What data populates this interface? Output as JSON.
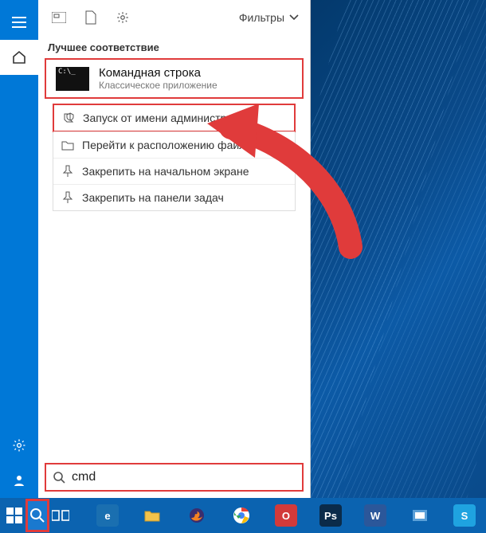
{
  "toolbar": {
    "filters_label": "Фильтры"
  },
  "section": {
    "best_match": "Лучшее соответствие"
  },
  "best": {
    "title": "Командная строка",
    "subtitle": "Классическое приложение"
  },
  "context_menu": {
    "run_as_admin": "Запуск от имени администратора",
    "open_location": "Перейти к расположению файла",
    "pin_start": "Закрепить на начальном экране",
    "pin_taskbar": "Закрепить на панели задач"
  },
  "search": {
    "value": "cmd",
    "placeholder": ""
  },
  "taskbar_apps": [
    {
      "name": "edge",
      "bg": "#1a6fb0",
      "label": "e"
    },
    {
      "name": "explorer",
      "bg": "#f3c34b",
      "label": ""
    },
    {
      "name": "firefox",
      "bg": "#3a2d6e",
      "label": ""
    },
    {
      "name": "chrome",
      "bg": "#ffffff",
      "label": ""
    },
    {
      "name": "opera",
      "bg": "#d23a3a",
      "label": "O"
    },
    {
      "name": "photoshop",
      "bg": "#0b2b4a",
      "label": "Ps"
    },
    {
      "name": "word",
      "bg": "#2b579a",
      "label": "W"
    },
    {
      "name": "videolan",
      "bg": "#5aa0d8",
      "label": ""
    },
    {
      "name": "skype",
      "bg": "#1fa3e0",
      "label": "S"
    }
  ],
  "colors": {
    "accent": "#0078d7",
    "highlight": "#e03b3b"
  }
}
